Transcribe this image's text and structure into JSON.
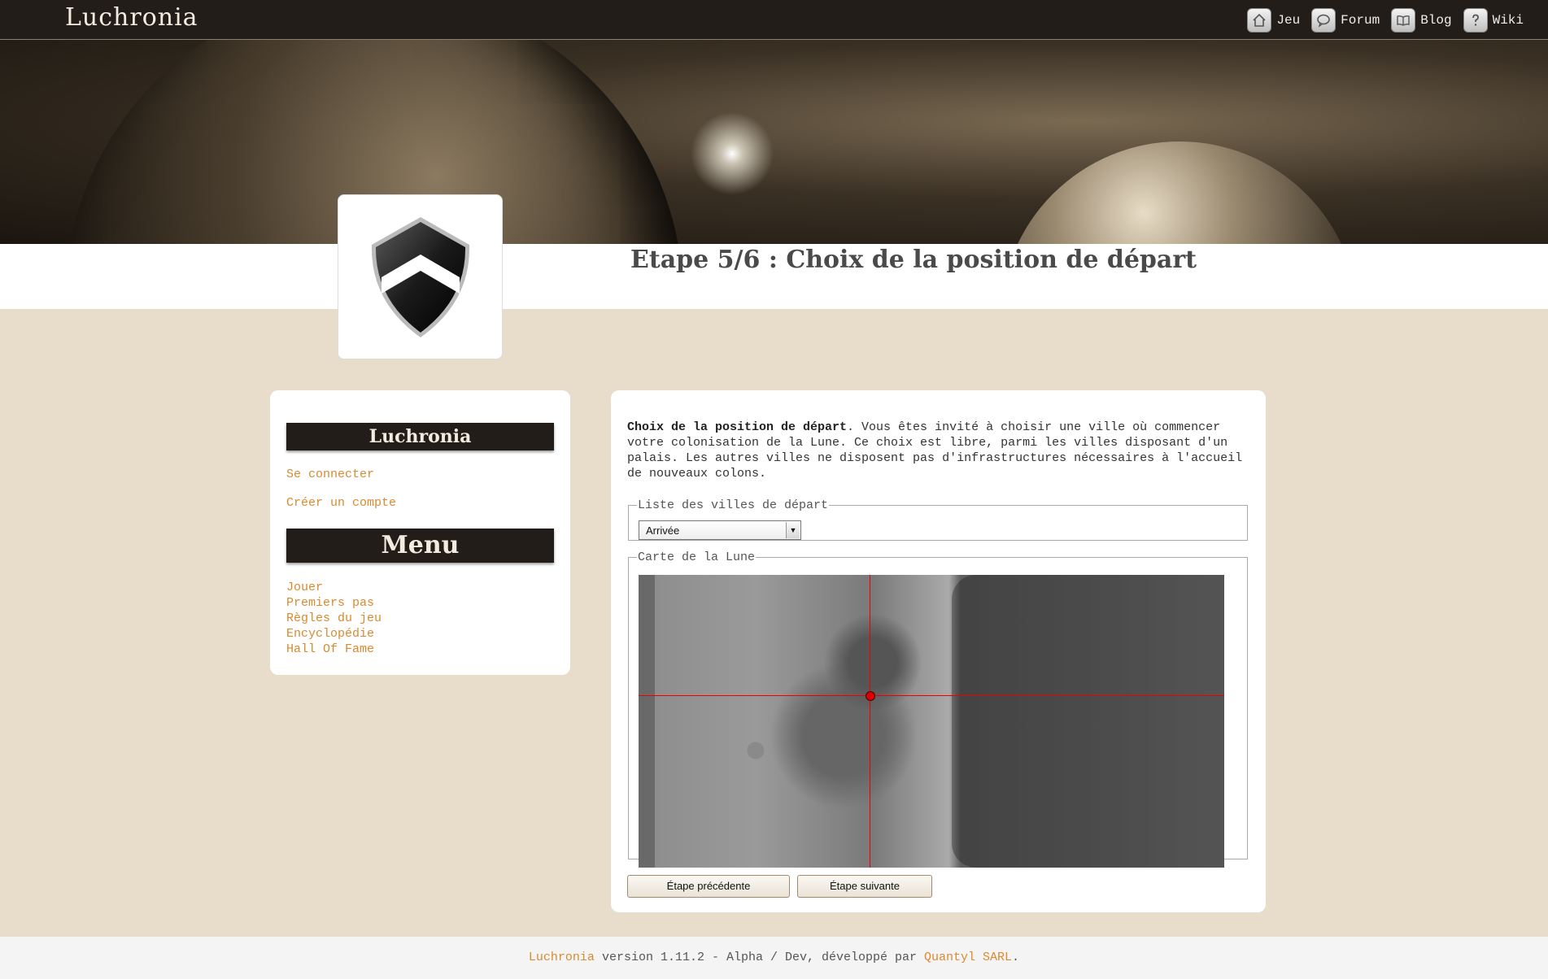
{
  "topbar": {
    "site_title": "Luchronia",
    "nav": [
      {
        "label": "Jeu",
        "icon": "home-icon"
      },
      {
        "label": "Forum",
        "icon": "speech-bubble-icon"
      },
      {
        "label": "Blog",
        "icon": "book-icon"
      },
      {
        "label": "Wiki",
        "icon": "question-icon"
      }
    ]
  },
  "header": {
    "heading": "Etape 5/6 : Choix de la position de départ",
    "logo_icon": "shield-chevron-icon"
  },
  "sidebar": {
    "title": "Luchronia",
    "account_links": [
      "Se connecter",
      "Créer un compte"
    ],
    "menu_title": "Menu",
    "menu_links": [
      "Jouer",
      "Premiers pas",
      "Règles du jeu",
      "Encyclopédie",
      "Hall Of Fame"
    ]
  },
  "main": {
    "intro_bold": "Choix de la position de départ",
    "intro_text": ". Vous êtes invité à choisir une ville où commencer votre colonisation de la Lune. Ce choix est libre, parmi les villes disposant d'un palais. Les autres villes ne disposent pas d'infrastructures nécessaires à l'accueil de nouveaux colons.",
    "cities_legend": "Liste des villes de départ",
    "selected_city": "Arrivée",
    "map_legend": "Carte de la Lune",
    "btn_prev": "Étape précédente",
    "btn_next": "Étape suivante"
  },
  "footer": {
    "app_link": "Luchronia",
    "version_text": " version 1.11.2 - Alpha / Dev, développé par ",
    "company_link": "Quantyl SARL",
    "end": "."
  },
  "colors": {
    "accent": "#d98a2f",
    "dark": "#221d18",
    "page_bg": "#e8ddcb",
    "marker": "#dd0000"
  }
}
